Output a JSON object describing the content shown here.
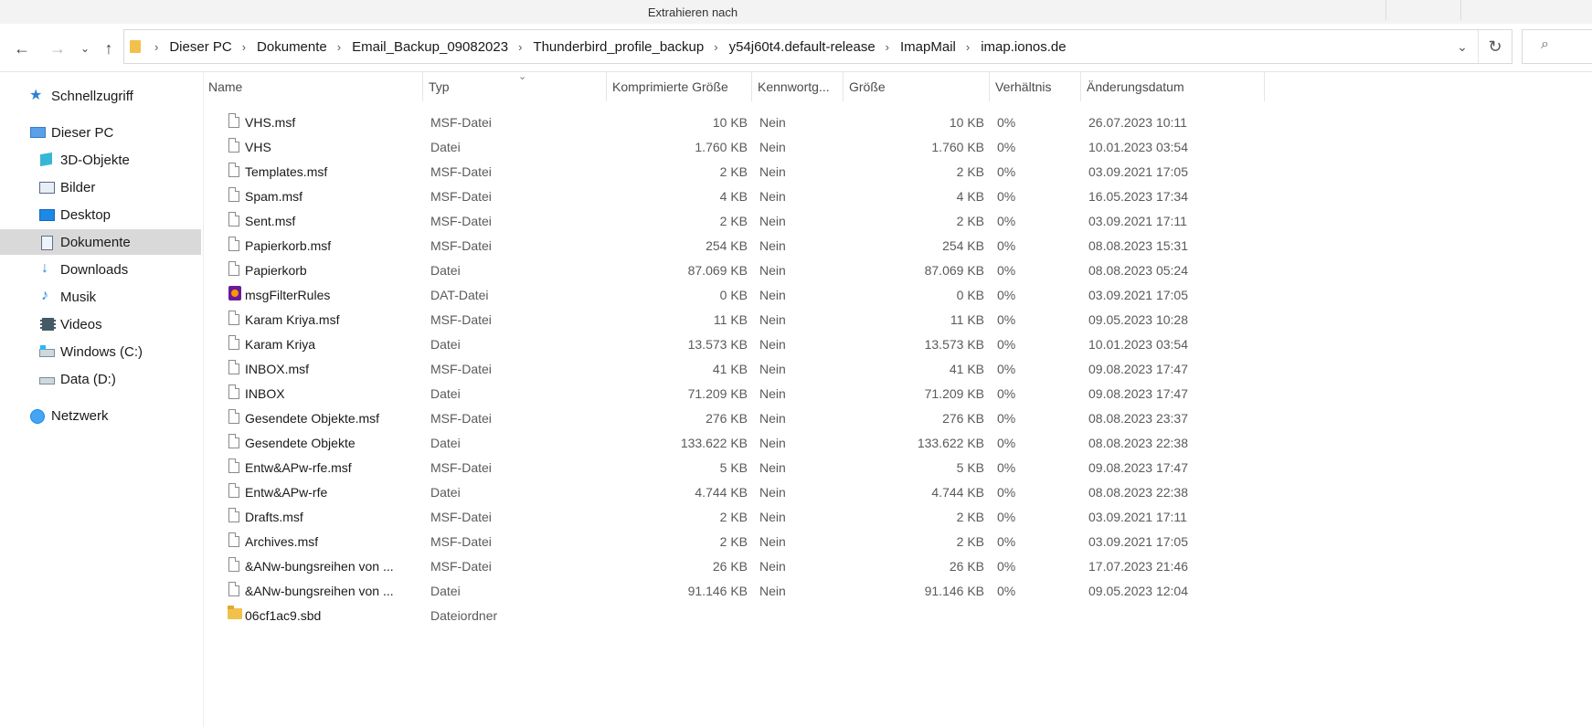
{
  "ribbon": {
    "title": "Extrahieren nach"
  },
  "breadcrumbs": [
    "Dieser PC",
    "Dokumente",
    "Email_Backup_09082023",
    "Thunderbird_profile_backup",
    "y54j60t4.default-release",
    "ImapMail",
    "imap.ionos.de"
  ],
  "sidebar": {
    "items": [
      {
        "label": "Schnellzugriff",
        "icon": "star-icon"
      },
      {
        "label": "Dieser PC",
        "icon": "computer-icon"
      },
      {
        "label": "3D-Objekte",
        "icon": "cube-icon"
      },
      {
        "label": "Bilder",
        "icon": "pictures-icon"
      },
      {
        "label": "Desktop",
        "icon": "desktop-icon"
      },
      {
        "label": "Dokumente",
        "icon": "documents-icon",
        "selected": true
      },
      {
        "label": "Downloads",
        "icon": "download-icon"
      },
      {
        "label": "Musik",
        "icon": "music-icon"
      },
      {
        "label": "Videos",
        "icon": "video-icon"
      },
      {
        "label": "Windows (C:)",
        "icon": "drive-icon"
      },
      {
        "label": "Data (D:)",
        "icon": "drive-icon"
      },
      {
        "label": "Netzwerk",
        "icon": "network-icon"
      }
    ]
  },
  "columns": {
    "name": "Name",
    "type": "Typ",
    "compressed": "Komprimierte Größe",
    "password": "Kennwortg...",
    "size": "Größe",
    "ratio": "Verhältnis",
    "date": "Änderungsdatum"
  },
  "files": [
    {
      "name": "VHS.msf",
      "type": "MSF-Datei",
      "compressed": "10 KB",
      "password": "Nein",
      "size": "10 KB",
      "ratio": "0%",
      "date": "26.07.2023 10:11",
      "icon": "file"
    },
    {
      "name": "VHS",
      "type": "Datei",
      "compressed": "1.760 KB",
      "password": "Nein",
      "size": "1.760 KB",
      "ratio": "0%",
      "date": "10.01.2023 03:54",
      "icon": "file"
    },
    {
      "name": "Templates.msf",
      "type": "MSF-Datei",
      "compressed": "2 KB",
      "password": "Nein",
      "size": "2 KB",
      "ratio": "0%",
      "date": "03.09.2021 17:05",
      "icon": "file"
    },
    {
      "name": "Spam.msf",
      "type": "MSF-Datei",
      "compressed": "4 KB",
      "password": "Nein",
      "size": "4 KB",
      "ratio": "0%",
      "date": "16.05.2023 17:34",
      "icon": "file"
    },
    {
      "name": "Sent.msf",
      "type": "MSF-Datei",
      "compressed": "2 KB",
      "password": "Nein",
      "size": "2 KB",
      "ratio": "0%",
      "date": "03.09.2021 17:11",
      "icon": "file"
    },
    {
      "name": "Papierkorb.msf",
      "type": "MSF-Datei",
      "compressed": "254 KB",
      "password": "Nein",
      "size": "254 KB",
      "ratio": "0%",
      "date": "08.08.2023 15:31",
      "icon": "file"
    },
    {
      "name": "Papierkorb",
      "type": "Datei",
      "compressed": "87.069 KB",
      "password": "Nein",
      "size": "87.069 KB",
      "ratio": "0%",
      "date": "08.08.2023 05:24",
      "icon": "file"
    },
    {
      "name": "msgFilterRules",
      "type": "DAT-Datei",
      "compressed": "0 KB",
      "password": "Nein",
      "size": "0 KB",
      "ratio": "0%",
      "date": "03.09.2021 17:05",
      "icon": "dat"
    },
    {
      "name": "Karam Kriya.msf",
      "type": "MSF-Datei",
      "compressed": "11 KB",
      "password": "Nein",
      "size": "11 KB",
      "ratio": "0%",
      "date": "09.05.2023 10:28",
      "icon": "file"
    },
    {
      "name": "Karam Kriya",
      "type": "Datei",
      "compressed": "13.573 KB",
      "password": "Nein",
      "size": "13.573 KB",
      "ratio": "0%",
      "date": "10.01.2023 03:54",
      "icon": "file"
    },
    {
      "name": "INBOX.msf",
      "type": "MSF-Datei",
      "compressed": "41 KB",
      "password": "Nein",
      "size": "41 KB",
      "ratio": "0%",
      "date": "09.08.2023 17:47",
      "icon": "file"
    },
    {
      "name": "INBOX",
      "type": "Datei",
      "compressed": "71.209 KB",
      "password": "Nein",
      "size": "71.209 KB",
      "ratio": "0%",
      "date": "09.08.2023 17:47",
      "icon": "file"
    },
    {
      "name": "Gesendete Objekte.msf",
      "type": "MSF-Datei",
      "compressed": "276 KB",
      "password": "Nein",
      "size": "276 KB",
      "ratio": "0%",
      "date": "08.08.2023 23:37",
      "icon": "file"
    },
    {
      "name": "Gesendete Objekte",
      "type": "Datei",
      "compressed": "133.622 KB",
      "password": "Nein",
      "size": "133.622 KB",
      "ratio": "0%",
      "date": "08.08.2023 22:38",
      "icon": "file"
    },
    {
      "name": "Entw&APw-rfe.msf",
      "type": "MSF-Datei",
      "compressed": "5 KB",
      "password": "Nein",
      "size": "5 KB",
      "ratio": "0%",
      "date": "09.08.2023 17:47",
      "icon": "file"
    },
    {
      "name": "Entw&APw-rfe",
      "type": "Datei",
      "compressed": "4.744 KB",
      "password": "Nein",
      "size": "4.744 KB",
      "ratio": "0%",
      "date": "08.08.2023 22:38",
      "icon": "file"
    },
    {
      "name": "Drafts.msf",
      "type": "MSF-Datei",
      "compressed": "2 KB",
      "password": "Nein",
      "size": "2 KB",
      "ratio": "0%",
      "date": "03.09.2021 17:11",
      "icon": "file"
    },
    {
      "name": "Archives.msf",
      "type": "MSF-Datei",
      "compressed": "2 KB",
      "password": "Nein",
      "size": "2 KB",
      "ratio": "0%",
      "date": "03.09.2021 17:05",
      "icon": "file"
    },
    {
      "name": "&ANw-bungsreihen von ...",
      "type": "MSF-Datei",
      "compressed": "26 KB",
      "password": "Nein",
      "size": "26 KB",
      "ratio": "0%",
      "date": "17.07.2023 21:46",
      "icon": "file"
    },
    {
      "name": "&ANw-bungsreihen von ...",
      "type": "Datei",
      "compressed": "91.146 KB",
      "password": "Nein",
      "size": "91.146 KB",
      "ratio": "0%",
      "date": "09.05.2023 12:04",
      "icon": "file"
    },
    {
      "name": "06cf1ac9.sbd",
      "type": "Dateiordner",
      "compressed": "",
      "password": "",
      "size": "",
      "ratio": "",
      "date": "",
      "icon": "folder"
    }
  ]
}
